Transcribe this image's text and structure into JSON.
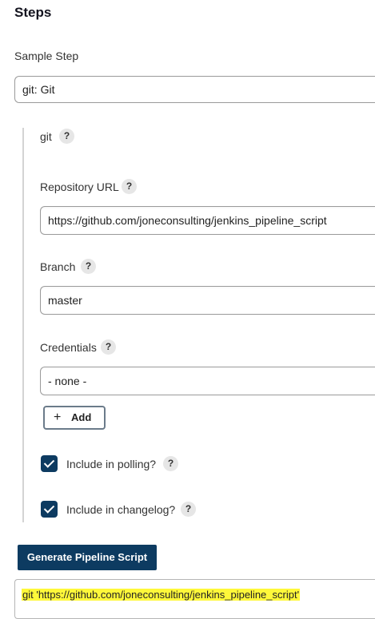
{
  "steps": {
    "heading": "Steps",
    "sample_step_label": "Sample Step",
    "sample_step_value": "git: Git"
  },
  "git_section": {
    "title": "git",
    "help": "?",
    "repository_url": {
      "label": "Repository URL",
      "value": "https://github.com/joneconsulting/jenkins_pipeline_script"
    },
    "branch": {
      "label": "Branch",
      "value": "master"
    },
    "credentials": {
      "label": "Credentials",
      "value": "- none -",
      "add_label": "Add",
      "add_icon": "+"
    },
    "include_in_polling": {
      "label": "Include in polling?",
      "checked": true
    },
    "include_in_changelog": {
      "label": "Include in changelog?",
      "checked": true
    }
  },
  "generate": {
    "button_label": "Generate Pipeline Script",
    "output": "git 'https://github.com/joneconsulting/jenkins_pipeline_script'"
  },
  "colors": {
    "primary": "#0d3b61",
    "highlight": "#fff83a"
  },
  "icons": {
    "help": "question-mark-icon",
    "add": "plus-icon",
    "checkbox": "checkmark-icon"
  }
}
